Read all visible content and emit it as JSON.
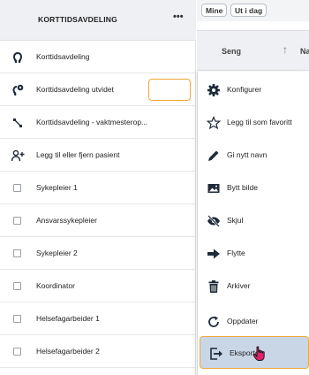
{
  "left_panel": {
    "title": "KORTTIDSAVDELING",
    "more_icon_glyph": "•••",
    "rows": [
      {
        "icon": "pin-icon",
        "label": "Korttidsavdeling"
      },
      {
        "icon": "gear-pin-icon",
        "label": "Korttidsavdeling utvidet"
      },
      {
        "icon": "wrench-icon",
        "label": "Korttidsavdeling - vaktmesterop..."
      },
      {
        "icon": "person-add-icon",
        "label": "Legg til eller fjern pasient"
      },
      {
        "icon": "checkbox",
        "label": "Sykepleier 1"
      },
      {
        "icon": "checkbox",
        "label": "Ansvarssykepleier"
      },
      {
        "icon": "checkbox",
        "label": "Sykepleier 2"
      },
      {
        "icon": "checkbox",
        "label": "Koordinator"
      },
      {
        "icon": "checkbox",
        "label": "Helsefagarbeider 1"
      },
      {
        "icon": "checkbox",
        "label": "Helsefagarbeider 2"
      }
    ]
  },
  "right_panel": {
    "filters": [
      "Mine",
      "Ut i dag"
    ],
    "column_header": {
      "seng": "Seng",
      "next": "Na"
    }
  },
  "context_menu": {
    "items": [
      {
        "icon": "gear-icon",
        "label": "Konfigurer"
      },
      {
        "icon": "star-icon",
        "label": "Legg til som favoritt"
      },
      {
        "icon": "pencil-icon",
        "label": "Gi nytt navn"
      },
      {
        "icon": "image-icon",
        "label": "Bytt bilde"
      },
      {
        "icon": "eye-off-icon",
        "label": "Skjul"
      },
      {
        "icon": "arrow-right-icon",
        "label": "Flytte"
      },
      {
        "icon": "trash-icon",
        "label": "Arkiver"
      },
      {
        "icon": "refresh-icon",
        "label": "Oppdater"
      },
      {
        "icon": "export-icon",
        "label": "Eksporter"
      }
    ],
    "highlighted_index": 8
  },
  "colors": {
    "accent_outline": "#f0a83a",
    "highlight_bg": "#c9d6e6",
    "icon_dark": "#1f2a3a"
  }
}
